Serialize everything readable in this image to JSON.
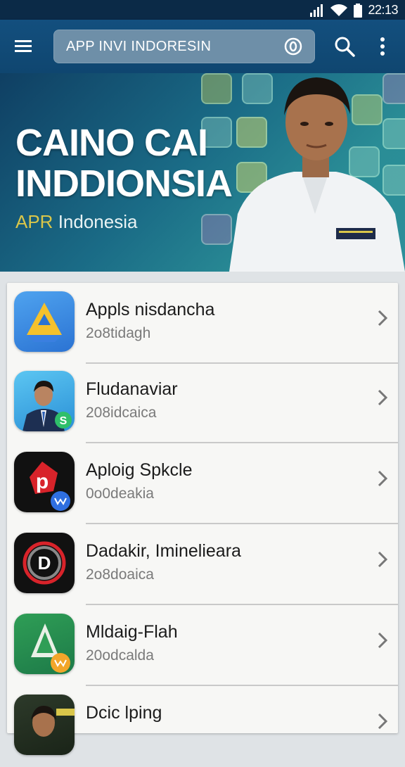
{
  "status_bar": {
    "time": "22:13",
    "icons": [
      "signal-icon",
      "wifi-icon",
      "battery-icon"
    ]
  },
  "app_bar": {
    "menu_icon": "hamburger-icon",
    "search_text": "APP INVI INDORESIN",
    "clear_icon": "clear-icon",
    "search_icon": "search-icon",
    "more_icon": "more-vertical-icon"
  },
  "banner": {
    "title_line1": "CAINO CAI",
    "title_line2": "INDDIONSIA",
    "subtitle_accent": "APR",
    "subtitle_rest": " Indonesia"
  },
  "apps": [
    {
      "name": "Appls nisdancha",
      "meta": "2o8tidagh",
      "icon": "drive-triangle-icon"
    },
    {
      "name": "Fludanaviar",
      "meta": "208idcaica",
      "icon": "news-anchor-icon"
    },
    {
      "name": "Aploig Spkcle",
      "meta": "0o0deakia",
      "icon": "red-p-icon"
    },
    {
      "name": "Dadakir, Iminelieara",
      "meta": "2o8doaica",
      "icon": "d-ring-icon"
    },
    {
      "name": "Mldaig-Flah",
      "meta": "20odcalda",
      "icon": "green-triangle-icon"
    },
    {
      "name": "Dcic lping",
      "meta": "",
      "icon": "profile-icon"
    }
  ],
  "colors": {
    "status_bar": "#0b2a47",
    "app_bar": "#134f7e",
    "search_box": "#6e8fa8",
    "banner_accent": "#d9c64a"
  }
}
